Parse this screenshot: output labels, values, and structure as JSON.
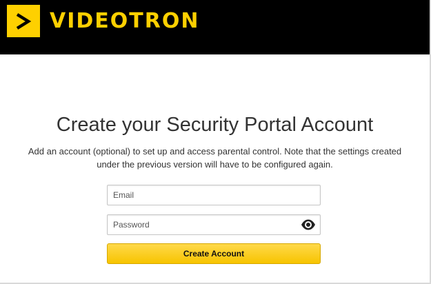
{
  "brand": {
    "name": "VIDEOTRON",
    "logo_icon": "chevron-right-icon",
    "accent_color": "#fed000",
    "header_color": "#000000"
  },
  "page": {
    "title": "Create your Security Portal Account",
    "description": "Add an account (optional) to set up and access parental control. Note that the settings created under the previous version will have to be configured again."
  },
  "form": {
    "email": {
      "placeholder": "Email",
      "value": ""
    },
    "password": {
      "placeholder": "Password",
      "value": "",
      "toggle_icon": "eye-icon"
    },
    "submit_label": "Create Account"
  }
}
